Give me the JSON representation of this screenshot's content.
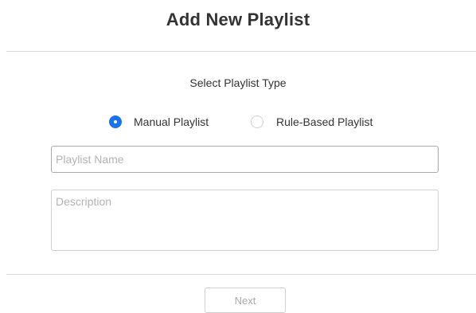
{
  "dialog": {
    "title": "Add New Playlist"
  },
  "playlist_type": {
    "heading": "Select Playlist Type",
    "options": [
      {
        "label": "Manual Playlist",
        "selected": true
      },
      {
        "label": "Rule-Based Playlist",
        "selected": false
      }
    ]
  },
  "form": {
    "name_placeholder": "Playlist Name",
    "name_value": "",
    "description_placeholder": "Description",
    "description_value": ""
  },
  "footer": {
    "next_label": "Next",
    "next_disabled": true
  },
  "colors": {
    "accent": "#1a73e8",
    "text": "#333333",
    "placeholder": "#b3b3b3",
    "divider": "#d6d6d6"
  }
}
